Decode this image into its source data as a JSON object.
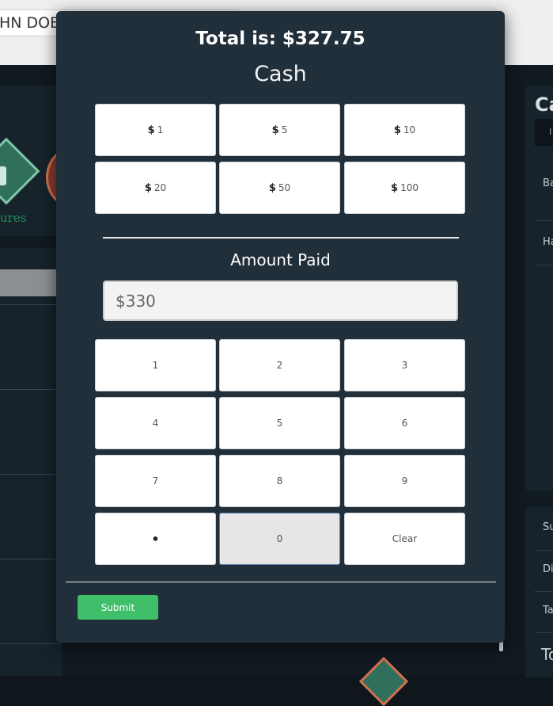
{
  "background": {
    "customer_name": "HN DOE",
    "tile_label": "ures",
    "right_panel_title": "Ca",
    "right_panel_tab": "I",
    "right_rows": [
      "Ba",
      "Ha"
    ],
    "summary_rows": [
      "Su",
      "Di",
      "Ta"
    ],
    "summary_total": "To"
  },
  "modal": {
    "total_text": "Total is: $327.75",
    "method_title": "Cash",
    "cash_buttons": [
      {
        "symbol": "$",
        "value": "1"
      },
      {
        "symbol": "$",
        "value": "5"
      },
      {
        "symbol": "$",
        "value": "10"
      },
      {
        "symbol": "$",
        "value": "20"
      },
      {
        "symbol": "$",
        "value": "50"
      },
      {
        "symbol": "$",
        "value": "100"
      }
    ],
    "amount_label": "Amount Paid",
    "amount_value": "$330",
    "keypad": [
      "1",
      "2",
      "3",
      "4",
      "5",
      "6",
      "7",
      "8",
      "9",
      "•",
      "0",
      "Clear"
    ],
    "keypad_active": "0",
    "submit_label": "Submit"
  },
  "colors": {
    "modal_bg": "#202f3a",
    "submit_green": "#3fbf69",
    "active_border": "#5b7fb0"
  }
}
